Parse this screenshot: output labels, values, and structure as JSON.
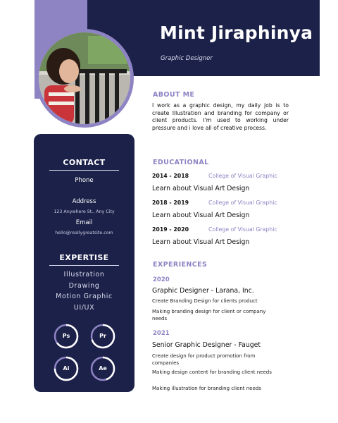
{
  "header": {
    "name": "Mint Jiraphinya",
    "role": "Graphic Designer"
  },
  "about": {
    "title": "ABOUT ME",
    "text": "I work as a graphic design, my daily job is to create Illustration and branding for company or client products. I'm used to working under pressure and i love all of creative process."
  },
  "contact": {
    "title": "CONTACT",
    "phone_label": "Phone",
    "address_label": "Address",
    "address": "123 Anywhere St., Any City",
    "email_label": "Email",
    "email": "hello@reallygreatsite.com"
  },
  "expertise": {
    "title": "EXPERTISE",
    "items": [
      "Illustration",
      "Drawing",
      "Motion Graphic",
      "UI/UX"
    ]
  },
  "software": [
    {
      "label": "Ps",
      "level": 0.65
    },
    {
      "label": "Pr",
      "level": 0.7
    },
    {
      "label": "Ai",
      "level": 0.75
    },
    {
      "label": "Ae",
      "level": 0.45
    }
  ],
  "education": {
    "title": "EDUCATIONAL",
    "entries": [
      {
        "years": "2014 - 2018",
        "school": "College of Visual Graphic",
        "desc": "Learn about Visual Art Design"
      },
      {
        "years": "2018 - 2019",
        "school": "College of Visual Graphic",
        "desc": "Learn about Visual Art Design"
      },
      {
        "years": "2019 - 2020",
        "school": "College of Visual Graphic",
        "desc": "Learn about Visual Art Design"
      }
    ]
  },
  "experience": {
    "title": "EXPERIENCES",
    "entries": [
      {
        "year": "2020",
        "title": "Graphic Designer - Larana, Inc.",
        "bullets": [
          "Create Branding Design for clients product",
          "Making branding design for client or company needs"
        ]
      },
      {
        "year": "2021",
        "title": "Senior Graphic Designer - Fauget",
        "bullets": [
          "Create design for product promotion from companies",
          "Making design content for branding client needs",
          "Making illustration for branding client  needs"
        ]
      }
    ]
  },
  "colors": {
    "navy": "#1c2149",
    "lavender": "#8e84c4",
    "white": "#ffffff"
  }
}
